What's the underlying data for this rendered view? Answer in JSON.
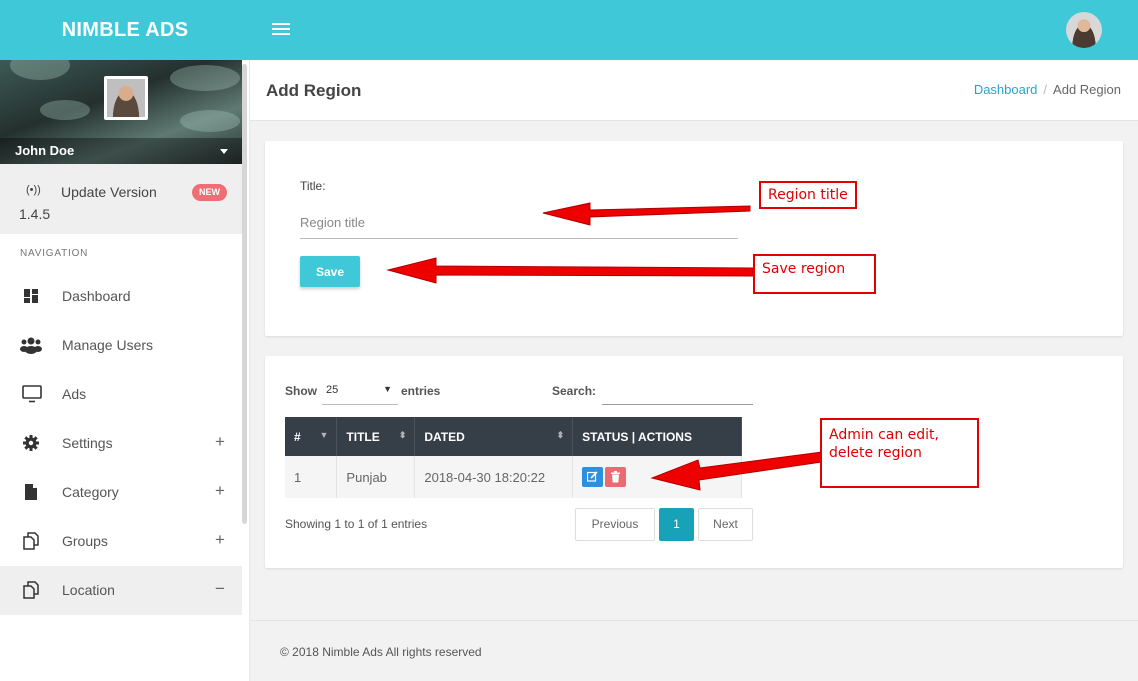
{
  "app": {
    "brand": "NIMBLE ADS",
    "accent": "#3ec8d8"
  },
  "sidebar": {
    "user_name": "John Doe",
    "update": {
      "label": "Update Version",
      "version": "1.4.5",
      "badge": "NEW"
    },
    "nav_header": "NAVIGATION",
    "items": [
      {
        "label": "Dashboard",
        "icon": "dashboard-icon",
        "expand": ""
      },
      {
        "label": "Manage Users",
        "icon": "users-icon",
        "expand": ""
      },
      {
        "label": "Ads",
        "icon": "monitor-icon",
        "expand": ""
      },
      {
        "label": "Settings",
        "icon": "gear-icon",
        "expand": "+"
      },
      {
        "label": "Category",
        "icon": "file-icon",
        "expand": "+"
      },
      {
        "label": "Groups",
        "icon": "copy-icon",
        "expand": "+"
      },
      {
        "label": "Location",
        "icon": "copy-icon",
        "expand": "−"
      }
    ]
  },
  "header": {
    "title": "Add Region",
    "breadcrumb": [
      "Dashboard",
      "Add Region"
    ]
  },
  "form": {
    "title_label": "Title:",
    "title_placeholder": "Region title",
    "title_value": "",
    "save_label": "Save"
  },
  "table": {
    "show_label": "Show",
    "length_value": "25",
    "entries_label": "entries",
    "search_label": "Search:",
    "search_value": "",
    "columns": [
      "#",
      "TITLE",
      "DATED",
      "STATUS | ACTIONS"
    ],
    "rows": [
      {
        "num": "1",
        "title": "Punjab",
        "dated": "2018-04-30 18:20:22"
      }
    ],
    "info": "Showing 1 to 1 of 1 entries",
    "pagination": {
      "previous": "Previous",
      "current": "1",
      "next": "Next"
    }
  },
  "footer": {
    "text": "© 2018 Nimble Ads All rights reserved"
  },
  "annotations": {
    "region_title": "Region title",
    "save_region": "Save region",
    "admin_edit_line1": "Admin can edit,",
    "admin_edit_line2": "delete region"
  }
}
